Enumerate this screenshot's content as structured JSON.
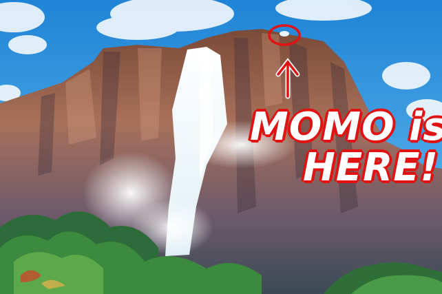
{
  "caption": {
    "line1": "MOMO is",
    "line2": "HERE!"
  },
  "colors": {
    "sky": "#2a8fd8",
    "annotation_red": "#e01212",
    "caption_fill": "#ffffff"
  },
  "annotations": {
    "marker": "red-circle",
    "pointer": "up-arrow"
  }
}
